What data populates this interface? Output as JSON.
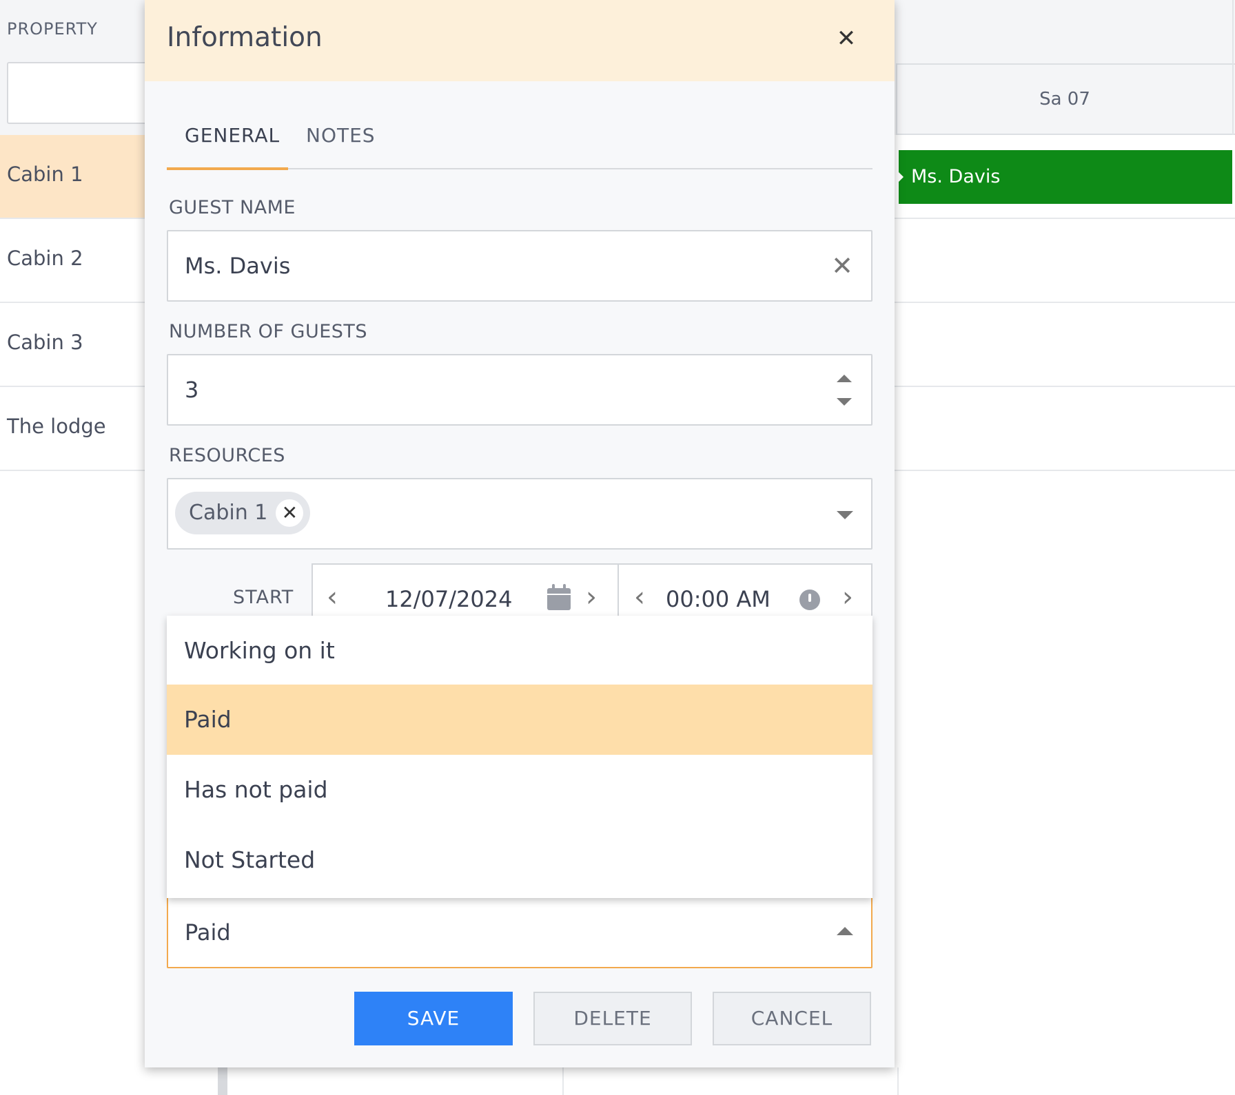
{
  "scheduler": {
    "property_header": "PROPERTY",
    "day_header": "Sa 07",
    "resources": [
      {
        "label": "Cabin 1",
        "selected": true
      },
      {
        "label": "Cabin 2",
        "selected": false
      },
      {
        "label": "Cabin 3",
        "selected": false
      },
      {
        "label": "The lodge",
        "selected": false
      }
    ],
    "event": {
      "label": "Ms. Davis",
      "color": "#0e8a17"
    }
  },
  "dialog": {
    "title": "Information",
    "close_icon": "close-icon",
    "tabs": [
      {
        "label": "GENERAL",
        "active": true
      },
      {
        "label": "NOTES",
        "active": false
      }
    ],
    "guest_name": {
      "label": "GUEST NAME",
      "value": "Ms. Davis"
    },
    "number_of_guests": {
      "label": "NUMBER OF GUESTS",
      "value": "3"
    },
    "resources": {
      "label": "RESOURCES",
      "chips": [
        "Cabin 1"
      ]
    },
    "start": {
      "label": "START",
      "date": "12/07/2024",
      "time": "00:00 AM"
    },
    "status": {
      "value": "Paid",
      "options": [
        "Working on it",
        "Paid",
        "Has not paid",
        "Not Started"
      ],
      "highlighted": "Paid"
    },
    "buttons": {
      "save": "SAVE",
      "delete": "DELETE",
      "cancel": "CANCEL"
    },
    "colors": {
      "header_bg": "#fdf0da",
      "accent": "#f2a94d",
      "save": "#2e82f7",
      "highlight": "#fedeaa"
    }
  }
}
